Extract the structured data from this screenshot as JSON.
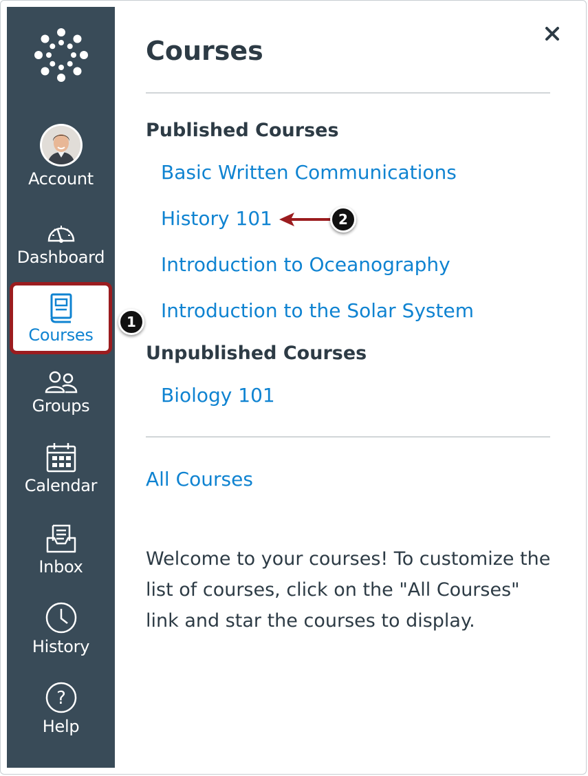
{
  "nav": {
    "items": [
      {
        "label": "Account",
        "icon": "avatar"
      },
      {
        "label": "Dashboard",
        "icon": "dashboard-icon"
      },
      {
        "label": "Courses",
        "icon": "book-icon"
      },
      {
        "label": "Groups",
        "icon": "groups-icon"
      },
      {
        "label": "Calendar",
        "icon": "calendar-icon"
      },
      {
        "label": "Inbox",
        "icon": "inbox-icon"
      },
      {
        "label": "History",
        "icon": "clock-icon"
      },
      {
        "label": "Help",
        "icon": "question-icon"
      }
    ],
    "active": "Courses"
  },
  "tray": {
    "title": "Courses",
    "close_icon": "close-icon",
    "published_heading": "Published Courses",
    "published": [
      "Basic Written Communications",
      "History 101",
      "Introduction to Oceanography",
      "Introduction to the Solar System"
    ],
    "unpublished_heading": "Unpublished Courses",
    "unpublished": [
      "Biology 101"
    ],
    "all_courses_label": "All Courses",
    "welcome_text": "Welcome to your courses! To customize the list of courses, click on the \"All Courses\" link and star the courses to display."
  },
  "callouts": {
    "one": "1",
    "two": "2"
  },
  "colors": {
    "nav_bg": "#394b58",
    "link": "#0f83d1",
    "highlight": "#9b1c1f",
    "text": "#2d3b45"
  }
}
